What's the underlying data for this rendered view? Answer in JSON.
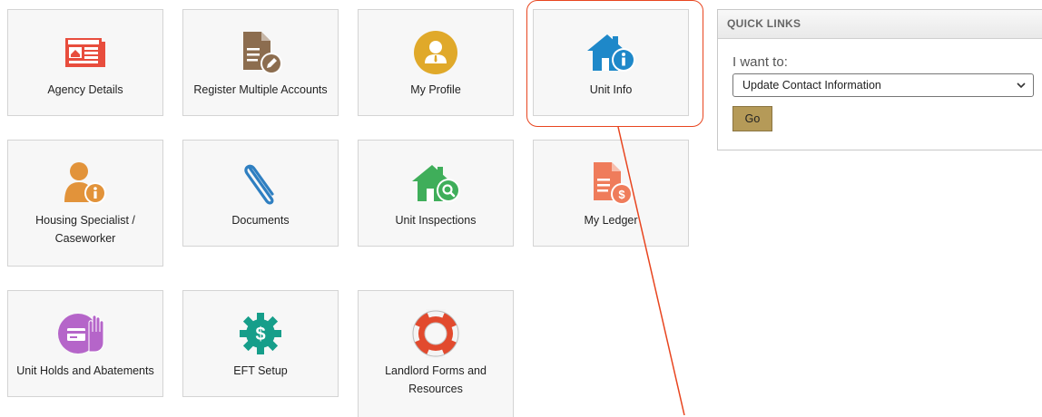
{
  "tiles": [
    {
      "id": "agency-details",
      "label": "Agency Details",
      "icon": "newspaper-icon"
    },
    {
      "id": "register-multiple-accounts",
      "label": "Register Multiple Accounts",
      "icon": "document-edit-icon"
    },
    {
      "id": "my-profile",
      "label": "My Profile",
      "icon": "user-profile-icon"
    },
    {
      "id": "unit-info",
      "label": "Unit Info",
      "icon": "house-info-icon"
    },
    {
      "id": "housing-specialist",
      "label_line1": "Housing Specialist /",
      "label_line2": "Caseworker",
      "icon": "person-info-icon"
    },
    {
      "id": "documents",
      "label": "Documents",
      "icon": "paperclip-icon"
    },
    {
      "id": "unit-inspections",
      "label": "Unit Inspections",
      "icon": "house-search-icon"
    },
    {
      "id": "my-ledger",
      "label": "My Ledger",
      "icon": "document-dollar-icon"
    },
    {
      "id": "unit-holds",
      "label": "Unit Holds and Abatements",
      "icon": "hand-card-icon"
    },
    {
      "id": "eft-setup",
      "label": "EFT Setup",
      "icon": "dollar-gear-icon"
    },
    {
      "id": "landlord-forms",
      "label_line1": "Landlord Forms and",
      "label_line2": "Resources",
      "icon": "lifebuoy-icon"
    }
  ],
  "quick_links": {
    "header": "QUICK LINKS",
    "prompt": "I want to:",
    "selected_option": "Update Contact Information",
    "go_label": "Go"
  },
  "colors": {
    "red": "#e84d3d",
    "brown": "#8c6d4f",
    "gold": "#e0a92a",
    "blue": "#1e88c9",
    "orange": "#e2933a",
    "green": "#3fae5a",
    "salmon": "#ef7c5b",
    "purple": "#b565c9",
    "teal": "#169e8a",
    "annotation": "#e8451f",
    "button": "#b59a58"
  }
}
